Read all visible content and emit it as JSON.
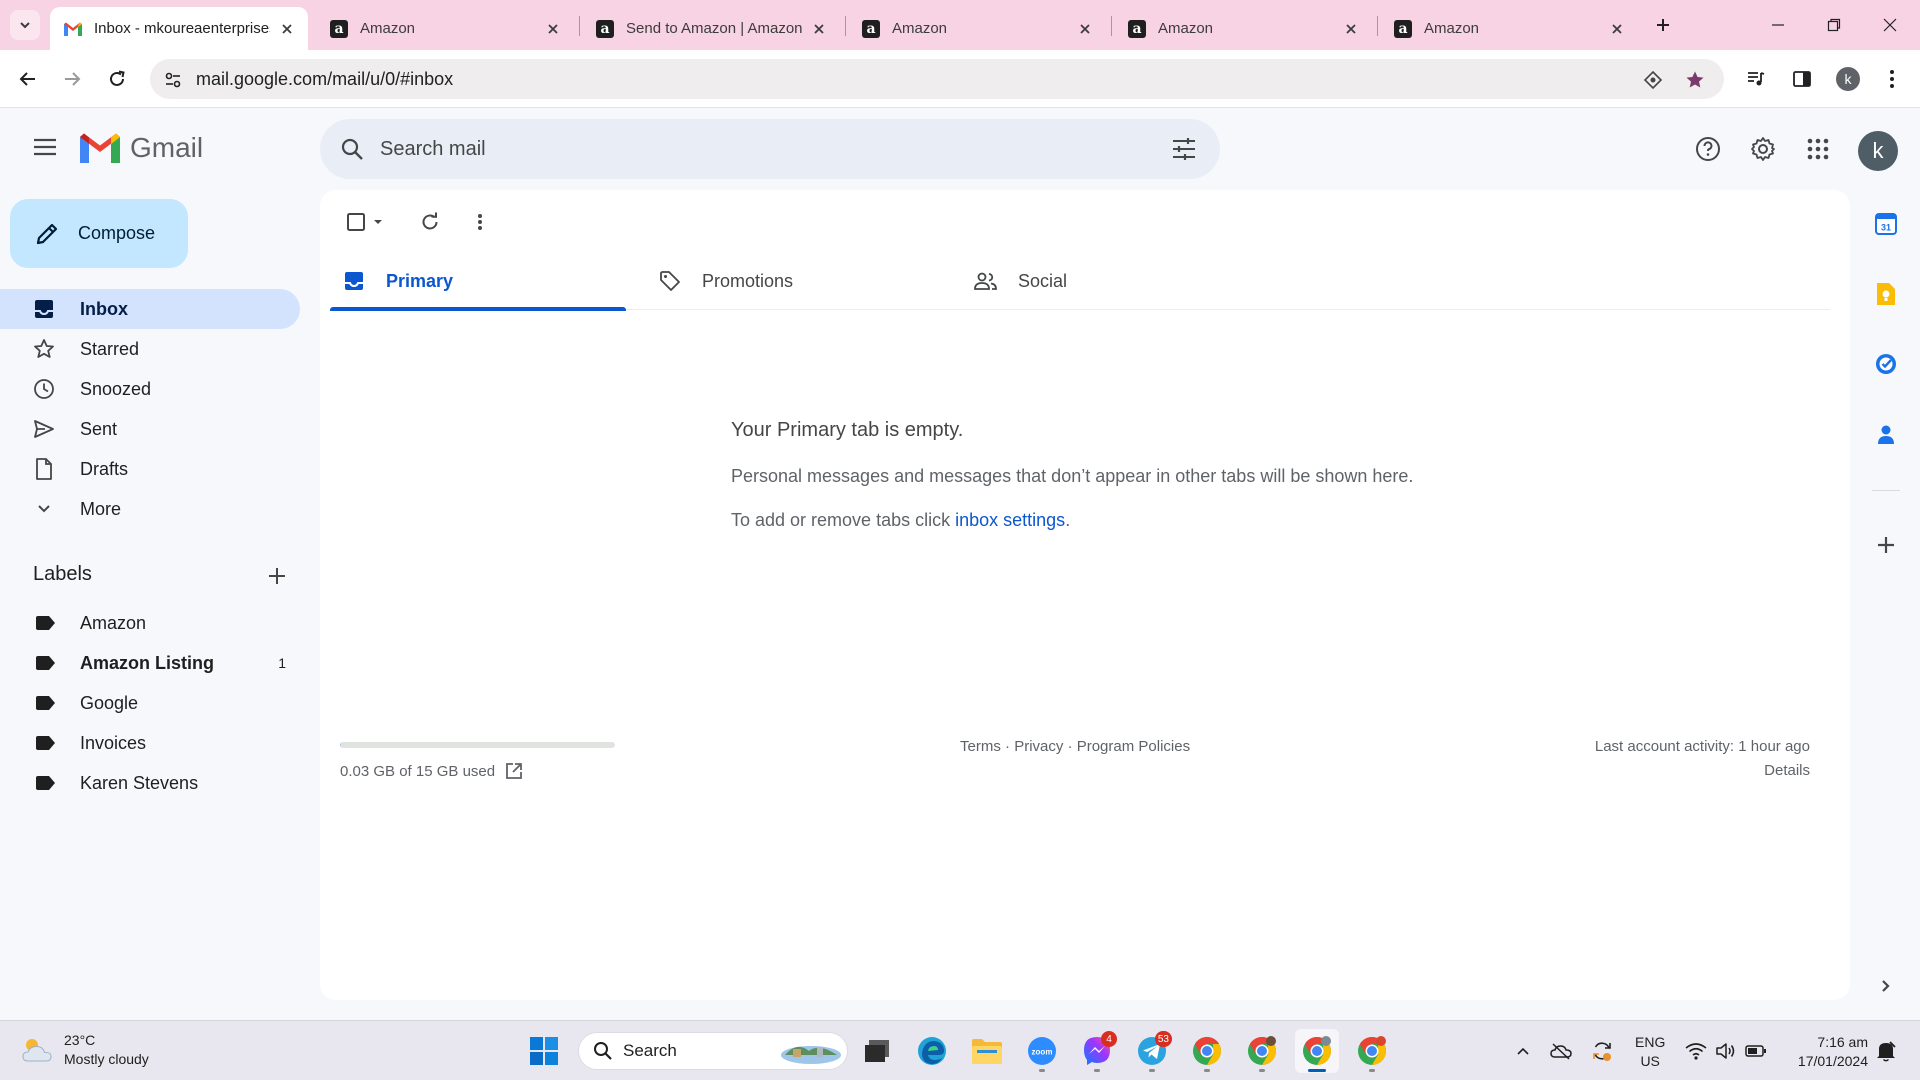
{
  "browser": {
    "tabs": [
      {
        "title": "Inbox - mkoureaenterprises",
        "active": true
      },
      {
        "title": "Amazon"
      },
      {
        "title": "Send to Amazon | Amazon"
      },
      {
        "title": "Amazon"
      },
      {
        "title": "Amazon"
      },
      {
        "title": "Amazon"
      }
    ],
    "url": "mail.google.com/mail/u/0/#inbox",
    "profile_initial": "k"
  },
  "gmail": {
    "brand": "Gmail",
    "search_placeholder": "Search mail",
    "avatar_initial": "k",
    "compose_label": "Compose",
    "nav": [
      {
        "label": "Inbox",
        "icon": "inbox-icon",
        "active": true
      },
      {
        "label": "Starred",
        "icon": "star-icon"
      },
      {
        "label": "Snoozed",
        "icon": "clock-icon"
      },
      {
        "label": "Sent",
        "icon": "send-icon"
      },
      {
        "label": "Drafts",
        "icon": "draft-icon"
      },
      {
        "label": "More",
        "icon": "chevron-down-icon"
      }
    ],
    "labels_heading": "Labels",
    "labels": [
      {
        "label": "Amazon",
        "count": ""
      },
      {
        "label": "Amazon Listing",
        "count": "1",
        "bold": true
      },
      {
        "label": "Google",
        "count": ""
      },
      {
        "label": "Invoices",
        "count": ""
      },
      {
        "label": "Karen Stevens",
        "count": ""
      }
    ],
    "tabs": [
      {
        "label": "Primary",
        "active": true
      },
      {
        "label": "Promotions"
      },
      {
        "label": "Social"
      }
    ],
    "empty": {
      "title": "Your Primary tab is empty.",
      "line1": "Personal messages and messages that don’t appear in other tabs will be shown here.",
      "line2_prefix": "To add or remove tabs click ",
      "line2_link": "inbox settings",
      "line2_suffix": "."
    },
    "footer": {
      "storage": "0.03 GB of 15 GB used",
      "storage_fraction": 0.002,
      "terms": "Terms",
      "privacy": "Privacy",
      "program_policies": "Program Policies",
      "separator": " · ",
      "last_activity": "Last account activity: 1 hour ago",
      "details": "Details"
    }
  },
  "taskbar": {
    "weather_temp": "23°C",
    "weather_desc": "Mostly cloudy",
    "search_label": "Search",
    "messenger_badge": "4",
    "telegram_badge": "53",
    "lang_top": "ENG",
    "lang_bottom": "US",
    "time": "7:16 am",
    "date": "17/01/2024"
  },
  "colors": {
    "accent": "#0b57d0",
    "compose_bg": "#c2e7ff",
    "active_nav": "#d3e3fd",
    "tabstrip": "#f7d3e3"
  }
}
